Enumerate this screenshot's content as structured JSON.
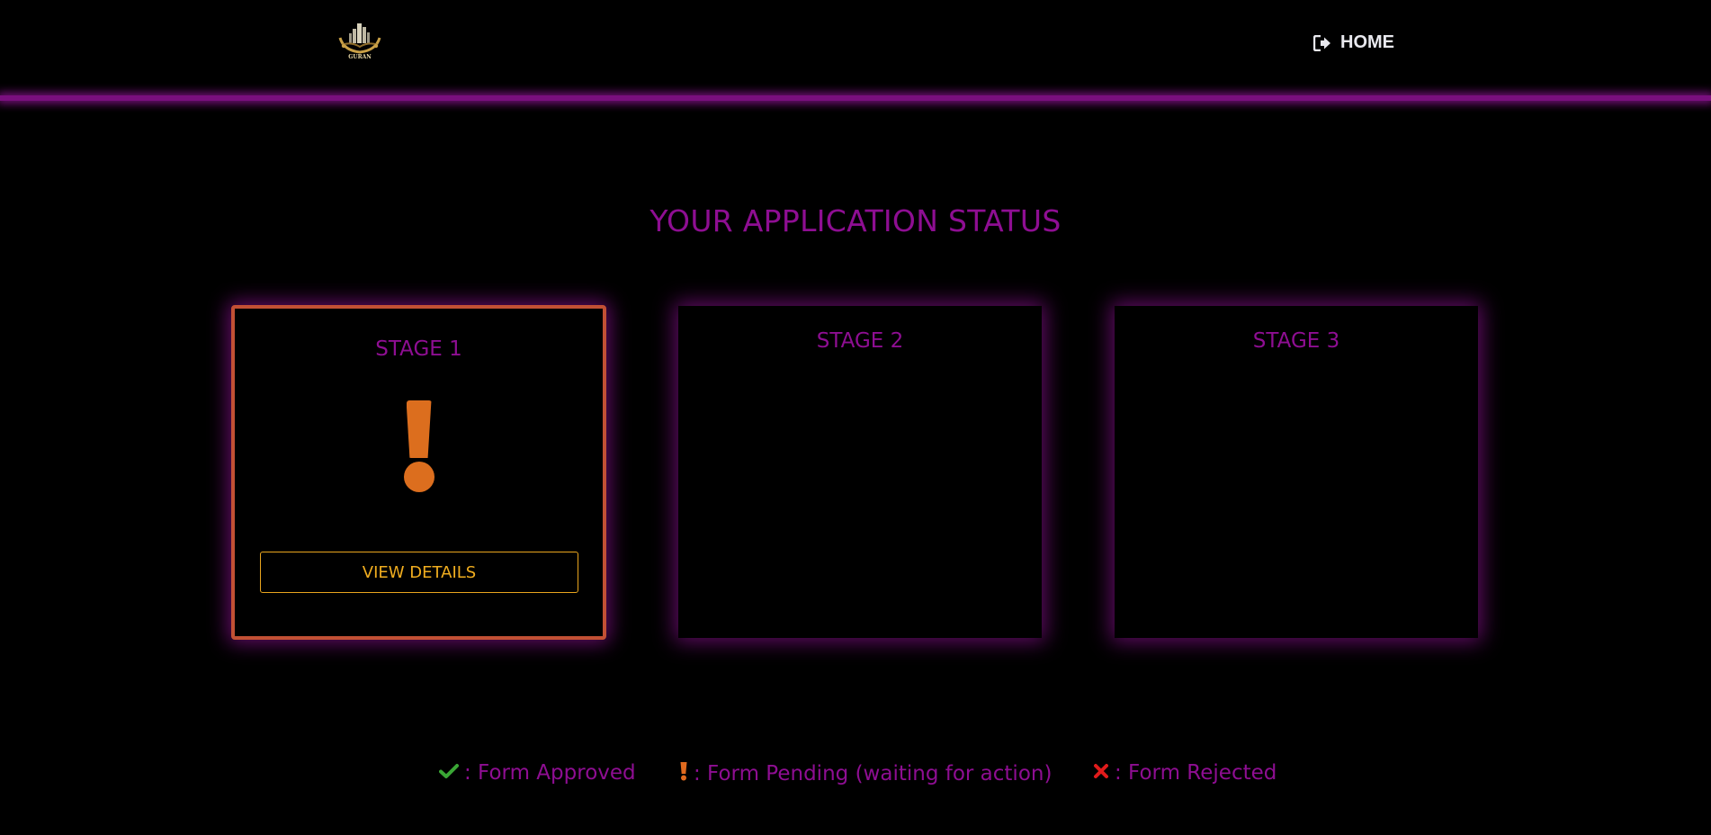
{
  "header": {
    "logo_text": "GURAN",
    "home_label": "HOME"
  },
  "page": {
    "title": "YOUR APPLICATION STATUS"
  },
  "stages": [
    {
      "label": "STAGE 1",
      "status": "pending",
      "button_label": "VIEW DETAILS"
    },
    {
      "label": "STAGE 2"
    },
    {
      "label": "STAGE 3"
    }
  ],
  "legend": {
    "approved": ": Form Approved",
    "pending": ": Form Pending (waiting for action)",
    "rejected": ": Form Rejected"
  },
  "colors": {
    "accent_purple": "#8e0e92",
    "pending_orange": "#dc6e1e",
    "button_gold": "#f0ad1f",
    "approved_green": "#3aa635",
    "rejected_red": "#e01b1b"
  },
  "icons": {
    "home": "sign-out-icon",
    "approved": "check-icon",
    "pending": "exclamation-icon",
    "rejected": "x-icon"
  }
}
